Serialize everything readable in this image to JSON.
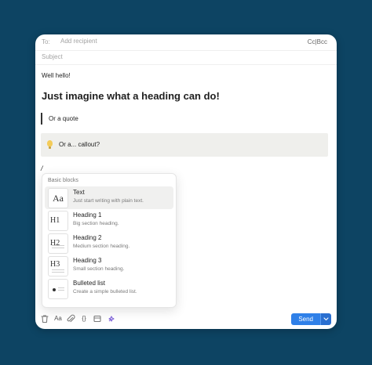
{
  "compose": {
    "to_label": "To:",
    "to_placeholder": "Add recipient",
    "cc_bcc": "Cc|Bcc",
    "subject_placeholder": "Subject"
  },
  "body": {
    "greeting": "Well hello!",
    "heading": "Just imagine what a heading can do!",
    "quote": "Or a quote",
    "callout": "Or a... callout?",
    "slash_char": "/"
  },
  "slash_menu": {
    "section_title": "Basic blocks",
    "items": [
      {
        "glyph": "Aa",
        "label": "Text",
        "desc": "Just start writing with plain text.",
        "icon": "text-block-icon"
      },
      {
        "glyph": "H1",
        "label": "Heading 1",
        "desc": "Big section heading.",
        "icon": "heading1-icon"
      },
      {
        "glyph": "H2",
        "label": "Heading 2",
        "desc": "Medium section heading.",
        "icon": "heading2-icon"
      },
      {
        "glyph": "H3",
        "label": "Heading 3",
        "desc": "Small section heading.",
        "icon": "heading3-icon"
      },
      {
        "glyph": "",
        "label": "Bulleted list",
        "desc": "Create a simple bulleted list.",
        "icon": "bulleted-list-icon"
      }
    ],
    "selected_index": 0
  },
  "toolbar": {
    "format_label": "Aa",
    "code_label": "{}",
    "send_label": "Send",
    "icons": [
      "trash-icon",
      "format-icon",
      "attachment-icon",
      "code-icon",
      "calendar-icon",
      "ai-sparkle-icon"
    ]
  },
  "colors": {
    "background": "#0d4463",
    "send_button": "#2f80e8",
    "callout_bg": "#efefec"
  }
}
